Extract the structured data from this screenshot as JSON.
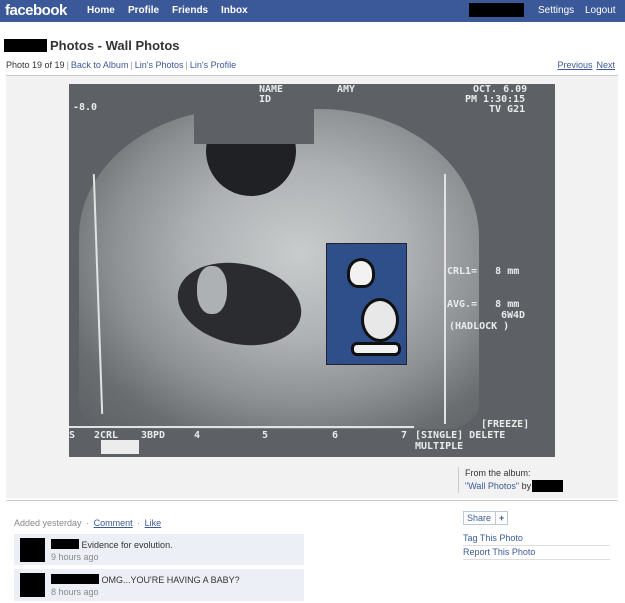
{
  "nav": {
    "logo": "facebook",
    "home": "Home",
    "profile": "Profile",
    "friends": "Friends",
    "inbox": "Inbox",
    "settings": "Settings",
    "logout": "Logout"
  },
  "header": {
    "title": "Photos - Wall Photos",
    "photo_count": "Photo 19 of 19",
    "back_to_album": "Back to Album",
    "owner_photos": "Lin's Photos",
    "owner_profile": "Lin's Profile",
    "previous": "Previous",
    "next": "Next"
  },
  "ultrasound": {
    "name_label": "NAME",
    "name_value": "AMY",
    "id_label": "ID",
    "date": "OCT. 6.09",
    "time": "PM 1:30:15",
    "tv": "TV G21",
    "depth": "-8.0",
    "crl": "CRL1=   8 mm",
    "avg": "AVG.=   8 mm",
    "weeks": "6W4D",
    "method": "(HADLOCK )",
    "freeze": "[FREEZE]",
    "single": "[SINGLE] DELETE",
    "multiple": "MULTIPLE",
    "scale": [
      "S",
      "2CRL",
      "3BPD",
      "4",
      "5",
      "6",
      "7"
    ]
  },
  "album": {
    "from_label": "From the album:",
    "album_name": "\"Wall Photos\"",
    "by_label": "by"
  },
  "comments_meta": {
    "added": "Added yesterday",
    "comment": "Comment",
    "like": "Like"
  },
  "comments": [
    {
      "text": "Evidence for evolution.",
      "time": "9 hours ago"
    },
    {
      "text": "OMG...YOU'RE HAVING A BABY?",
      "time": "8 hours ago"
    }
  ],
  "actions": {
    "share": "Share",
    "share_plus": "+",
    "tag": "Tag This Photo",
    "report": "Report This Photo"
  },
  "colors": {
    "brand": "#3b5998",
    "link": "#3b5998",
    "comment_bg": "#eceff5"
  }
}
